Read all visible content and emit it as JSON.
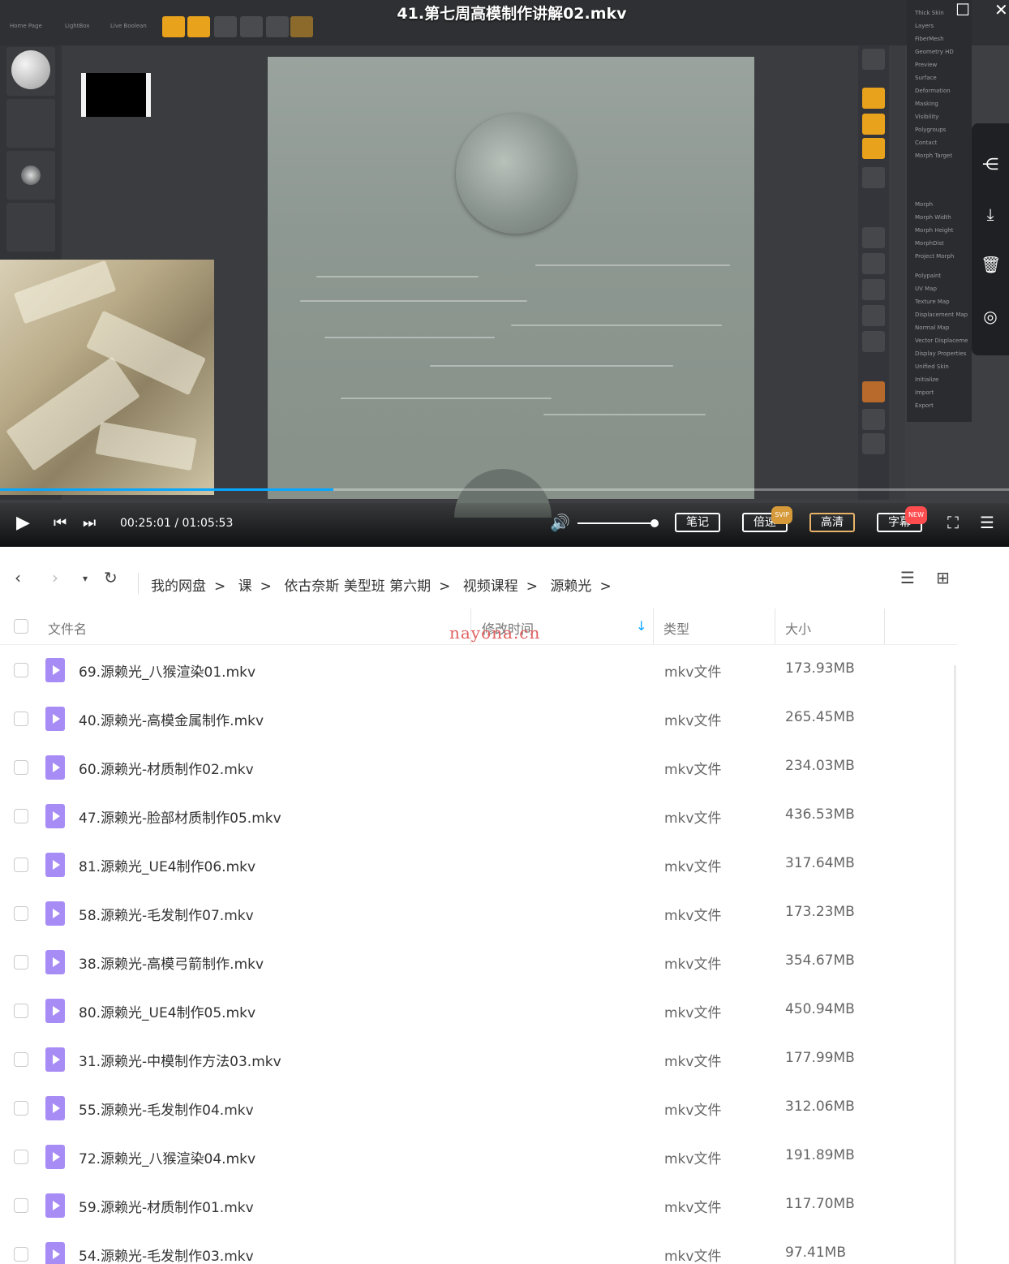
{
  "player": {
    "title": "41.第七周高模制作讲解02.mkv",
    "time": "00:25:01 / 01:05:53",
    "progress": 0.33,
    "volume": 1.0,
    "buttons": {
      "notes": "笔记",
      "speed": "倍速",
      "speed_badge": "SVIP",
      "quality": "高清",
      "subtitle": "字幕",
      "subtitle_badge": "NEW"
    },
    "zbrush_palette": [
      "Thick Skin",
      "Layers",
      "FiberMesh",
      "Geometry HD",
      "Preview",
      "Surface",
      "Deformation",
      "Masking",
      "Visibility",
      "Polygroups",
      "Contact",
      "Morph Target",
      "Morph",
      "Morph Width",
      "Morph Height",
      "MorphDist",
      "Project Morph",
      "Polypaint",
      "UV Map",
      "Texture Map",
      "Displacement Map",
      "Normal Map",
      "Vector Displaceme",
      "Display Properties",
      "Unified Skin",
      "Initialize",
      "Import",
      "Export"
    ],
    "zbrush_menus": [
      "Home Page",
      "LightBox",
      "Live Boolean"
    ]
  },
  "filemanager": {
    "breadcrumbs": [
      "我的网盘",
      "课",
      "依古奈斯 美型班 第六期",
      "视频课程",
      "源赖光"
    ],
    "columns": {
      "name": "文件名",
      "modified": "修改时间",
      "type": "类型",
      "size": "大小"
    },
    "watermark": "nayona.cn",
    "files": [
      {
        "name": "69.源赖光_八猴渲染01.mkv",
        "type": "mkv文件",
        "size": "173.93MB"
      },
      {
        "name": "40.源赖光-高模金属制作.mkv",
        "type": "mkv文件",
        "size": "265.45MB"
      },
      {
        "name": "60.源赖光-材质制作02.mkv",
        "type": "mkv文件",
        "size": "234.03MB"
      },
      {
        "name": "47.源赖光-脸部材质制作05.mkv",
        "type": "mkv文件",
        "size": "436.53MB"
      },
      {
        "name": "81.源赖光_UE4制作06.mkv",
        "type": "mkv文件",
        "size": "317.64MB"
      },
      {
        "name": "58.源赖光-毛发制作07.mkv",
        "type": "mkv文件",
        "size": "173.23MB"
      },
      {
        "name": "38.源赖光-高模弓箭制作.mkv",
        "type": "mkv文件",
        "size": "354.67MB"
      },
      {
        "name": "80.源赖光_UE4制作05.mkv",
        "type": "mkv文件",
        "size": "450.94MB"
      },
      {
        "name": "31.源赖光-中模制作方法03.mkv",
        "type": "mkv文件",
        "size": "177.99MB"
      },
      {
        "name": "55.源赖光-毛发制作04.mkv",
        "type": "mkv文件",
        "size": "312.06MB"
      },
      {
        "name": "72.源赖光_八猴渲染04.mkv",
        "type": "mkv文件",
        "size": "191.89MB"
      },
      {
        "name": "59.源赖光-材质制作01.mkv",
        "type": "mkv文件",
        "size": "117.70MB"
      },
      {
        "name": "54.源赖光-毛发制作03.mkv",
        "type": "mkv文件",
        "size": "97.41MB"
      }
    ]
  }
}
